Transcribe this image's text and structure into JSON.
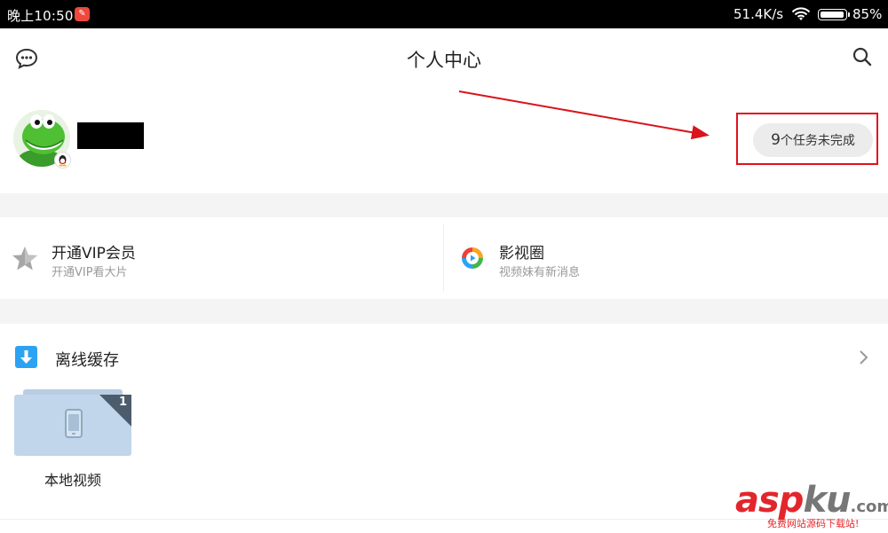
{
  "status_bar": {
    "time": "晚上10:50",
    "net_speed": "51.4K/s",
    "battery_percent": "85%",
    "battery_level": 0.85,
    "icons": [
      "app-notification-icon",
      "wifi-icon",
      "battery-icon"
    ]
  },
  "header": {
    "title": "个人中心",
    "left_icon": "chat-bubble-icon",
    "right_icon": "search-icon"
  },
  "profile": {
    "tasks_count": "9",
    "tasks_text": "个任务未完成",
    "highlight_color": "#e0121a"
  },
  "quick_links": [
    {
      "title": "开通VIP会员",
      "subtitle": "开通VIP看大片",
      "icon": "star-icon"
    },
    {
      "title": "影视圈",
      "subtitle": "视频妹有新消息",
      "icon": "film-circle-icon"
    }
  ],
  "offline_cache": {
    "title": "离线缓存",
    "icon": "download-icon",
    "items": [
      {
        "label": "本地视频",
        "count": "1",
        "icon": "phone-icon"
      }
    ]
  },
  "watermark": {
    "brand_red": "asp",
    "brand_gray": "ku",
    "suffix": ".com",
    "tagline": "免费网站源码下载站!"
  }
}
